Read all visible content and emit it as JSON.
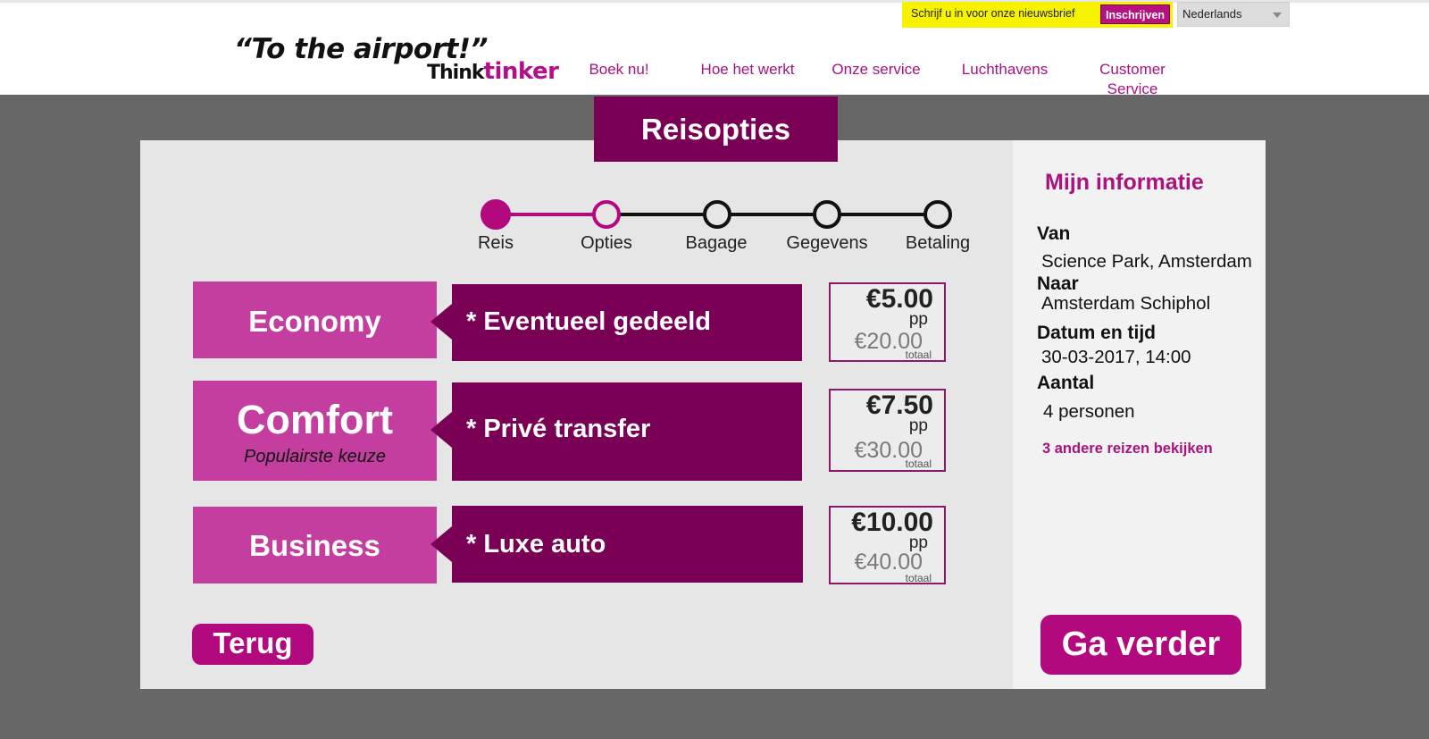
{
  "header": {
    "logo_line1": "“To the airport!”",
    "logo_think": "Think",
    "logo_tinker": "tinker",
    "nav": [
      {
        "label": "Boek nu!"
      },
      {
        "label": "Hoe het werkt"
      },
      {
        "label": "Onze service"
      },
      {
        "label": "Luchthavens"
      },
      {
        "label": "Customer Service"
      }
    ],
    "newsletter_text": "Schrijf u in voor onze nieuwsbrief",
    "newsletter_button": "Inschrijven",
    "language": "Nederlands"
  },
  "page_title": "Reisopties",
  "stepper": {
    "steps": [
      {
        "label": "Reis",
        "state": "done"
      },
      {
        "label": "Opties",
        "state": "current"
      },
      {
        "label": "Bagage",
        "state": "todo"
      },
      {
        "label": "Gegevens",
        "state": "todo"
      },
      {
        "label": "Betaling",
        "state": "todo"
      }
    ]
  },
  "options": [
    {
      "name": "Economy",
      "subtitle": "",
      "desc": "* Eventueel gedeeld",
      "price_pp": "€5.00",
      "pp_unit": "pp",
      "price_total": "€20.00",
      "total_unit": "totaal"
    },
    {
      "name": "Comfort",
      "subtitle": "Populairste keuze",
      "desc": "* Privé transfer",
      "price_pp": "€7.50",
      "pp_unit": "pp",
      "price_total": "€30.00",
      "total_unit": "totaal"
    },
    {
      "name": "Business",
      "subtitle": "",
      "desc": "* Luxe auto",
      "price_pp": "€10.00",
      "pp_unit": "pp",
      "price_total": "€40.00",
      "total_unit": "totaal"
    }
  ],
  "buttons": {
    "back": "Terug",
    "next": "Ga verder"
  },
  "info": {
    "title": "Mijn informatie",
    "from_label": "Van",
    "from_value": "Science Park, Amsterdam",
    "to_label": "Naar",
    "to_value": "Amsterdam Schiphol",
    "datetime_label": "Datum en tijd",
    "datetime_value": "30-03-2017, 14:00",
    "count_label": "Aantal",
    "count_value": "4 personen",
    "other_trips_link": "3 andere reizen bekijken"
  },
  "colors": {
    "brand_purple": "#7a0055",
    "accent_magenta": "#b3097f",
    "option_pink": "#c43ea0",
    "newsletter_yellow": "#f6f200",
    "background_gray": "#676767"
  }
}
